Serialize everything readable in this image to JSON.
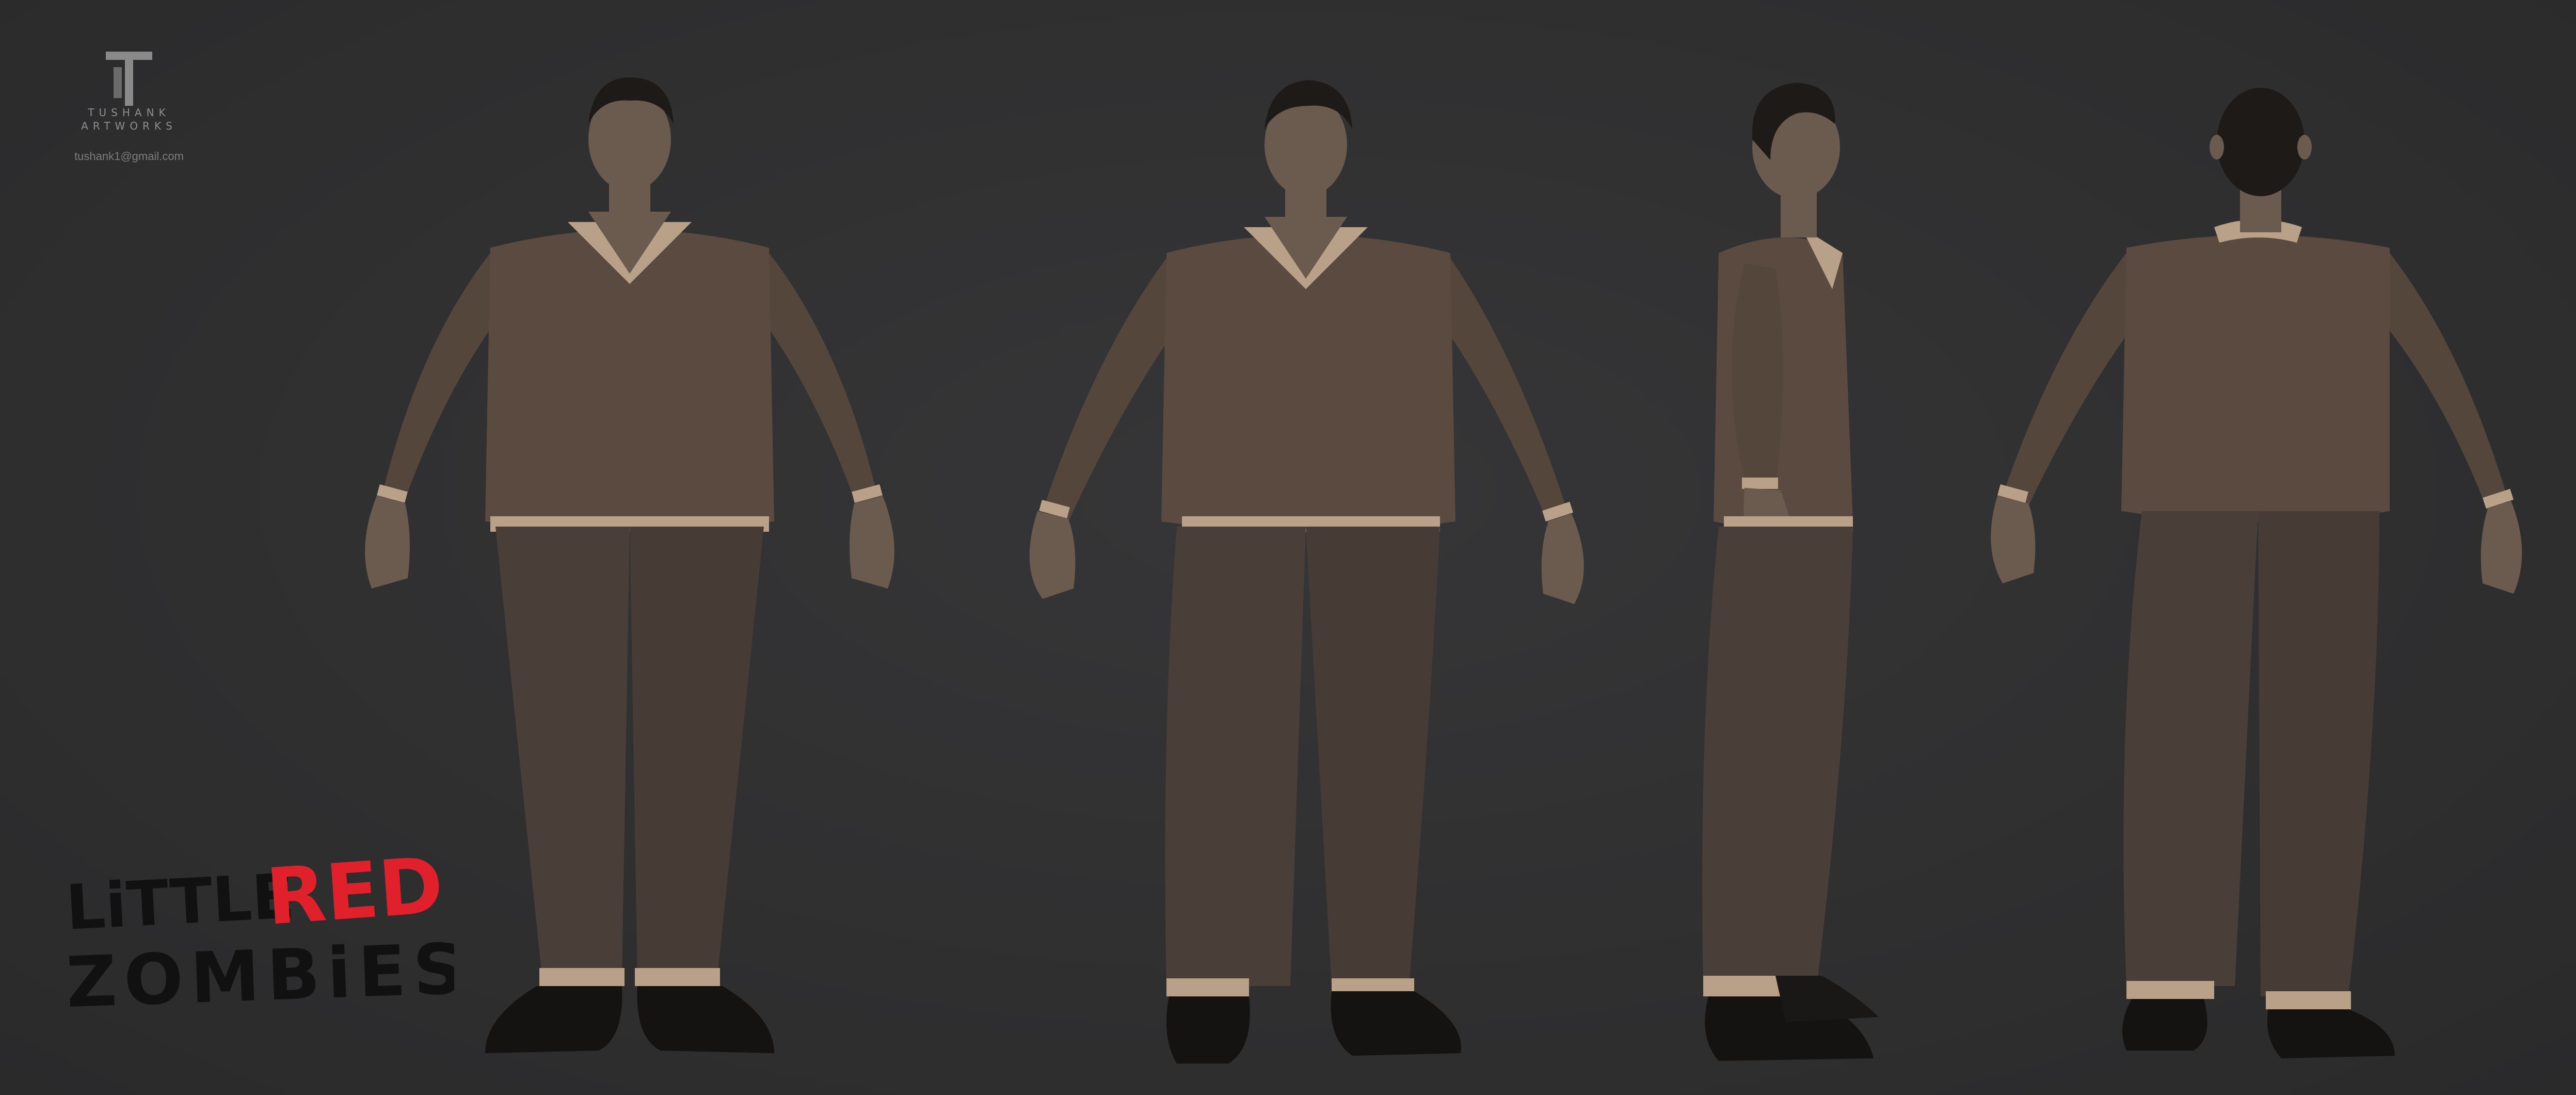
{
  "branding": {
    "studio_line1": "TUSHANK",
    "studio_line2": "ARTWORKS",
    "email": "tushank1@gmail.com"
  },
  "title": {
    "word1": "LiTTLE",
    "word2": "RED",
    "word3": "ZOMBiES"
  },
  "colors": {
    "background": "#2f2f30",
    "sweater": "#5a4a40",
    "pants": "#4a3f38",
    "skin": "#6b5a4e",
    "collar": "#b9a189",
    "shoes": "#141312",
    "title_black": "#111111",
    "title_red": "#e0202a"
  },
  "views": [
    "front",
    "front-three-quarter",
    "side-profile",
    "back"
  ]
}
